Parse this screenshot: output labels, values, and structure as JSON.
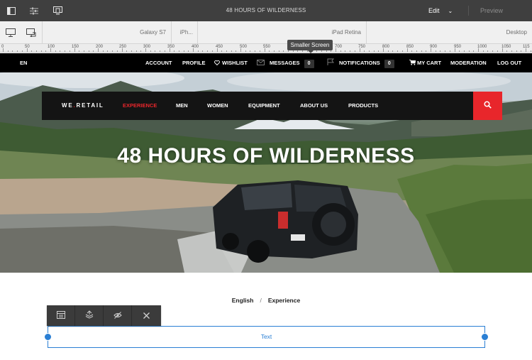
{
  "editor": {
    "page_title": "48 HOURS OF WILDERNESS",
    "mode": "Edit",
    "preview_label": "Preview",
    "icons": [
      "toggle-side-panel-icon",
      "page-properties-icon",
      "emulator-icon"
    ]
  },
  "emulator": {
    "devices": [
      "Galaxy S7",
      "iPh...",
      "iPad Retina",
      "Desktop"
    ],
    "icons": [
      "desktop-icon",
      "rotate-device-icon"
    ]
  },
  "ruler": {
    "ticks": [
      "0",
      "50",
      "100",
      "150",
      "200",
      "250",
      "300",
      "350",
      "400",
      "450",
      "500",
      "550",
      "600",
      "650",
      "700",
      "750",
      "800",
      "850",
      "900",
      "950",
      "1000",
      "1050",
      "115"
    ]
  },
  "tooltip": "Smaller Screen",
  "util_nav": {
    "language": "EN",
    "items": {
      "account": "ACCOUNT",
      "profile": "PROFILE",
      "wishlist": "WISHLIST",
      "messages": "MESSAGES",
      "messages_count": "0",
      "notifications": "NOTIFICATIONS",
      "notifications_count": "0",
      "cart": "MY CART",
      "moderation": "MODERATION",
      "logout": "LOG OUT"
    }
  },
  "main_nav": {
    "brand_part1": "WE",
    "brand_dot": ".",
    "brand_part2": "RETAIL",
    "items": [
      "EXPERIENCE",
      "MEN",
      "WOMEN",
      "EQUIPMENT",
      "ABOUT US",
      "PRODUCTS"
    ],
    "active": "EXPERIENCE",
    "accent_color": "#e8262b"
  },
  "hero": {
    "title": "48 HOURS OF WILDERNESS"
  },
  "breadcrumb": {
    "items": [
      "English",
      "Experience"
    ],
    "separator": "/"
  },
  "component_toolbar": {
    "actions": [
      "configure-icon",
      "parent-icon",
      "hide-icon",
      "close-icon"
    ]
  },
  "text_component": {
    "label": "Text",
    "color": "#2a7fd4"
  }
}
